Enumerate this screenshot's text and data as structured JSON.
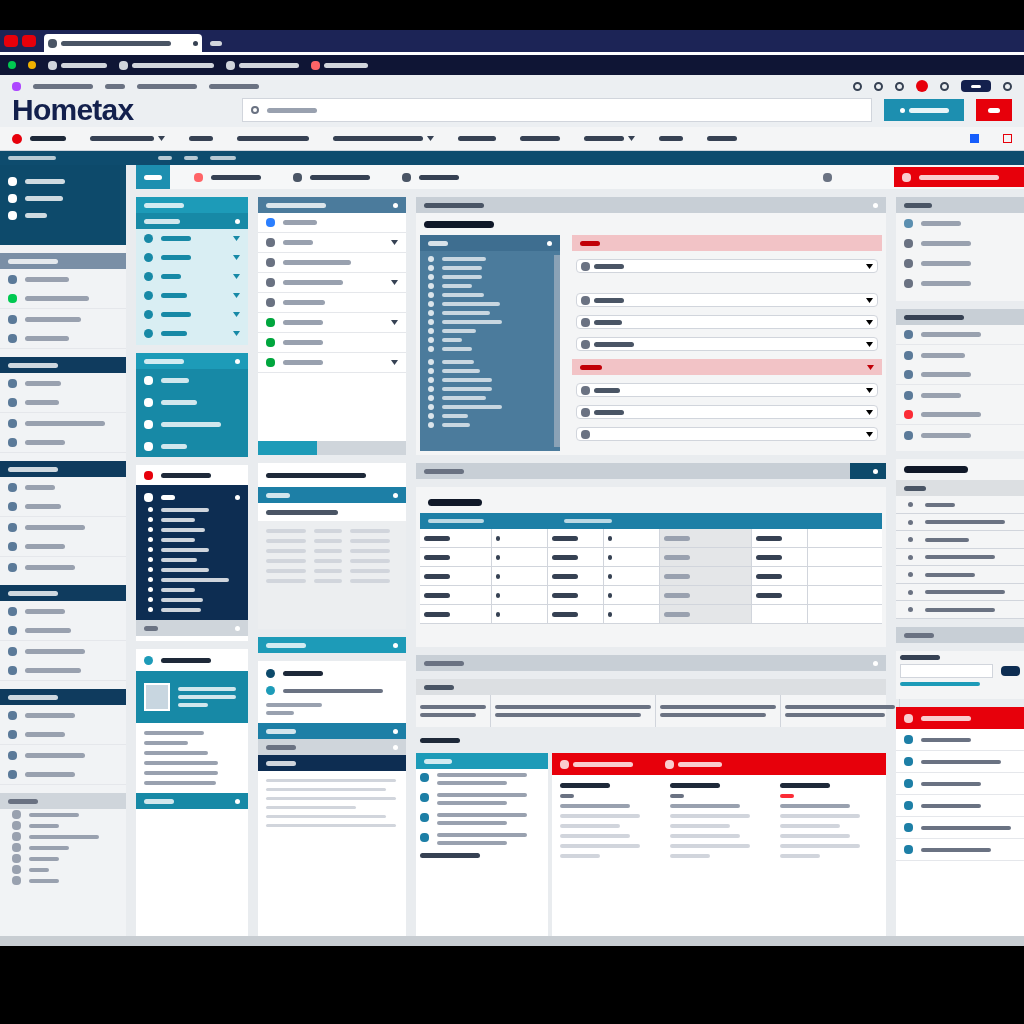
{
  "logo": {
    "text": "Hometax"
  },
  "progress": {
    "level": 0.4
  },
  "content_tabs": [
    {
      "selected": true
    },
    {
      "selected": false
    },
    {
      "selected": false
    },
    {
      "selected": false
    }
  ]
}
